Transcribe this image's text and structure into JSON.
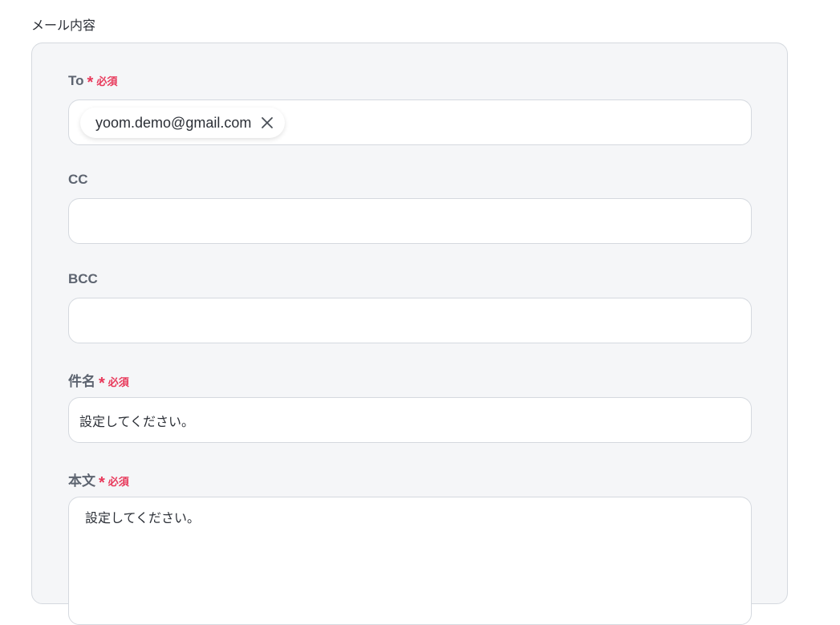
{
  "section": {
    "title": "メール内容"
  },
  "fields": {
    "to": {
      "label": "To",
      "required_mark": "*",
      "required_text": "必須",
      "chips": [
        {
          "email": "yoom.demo@gmail.com"
        }
      ]
    },
    "cc": {
      "label": "CC",
      "value": ""
    },
    "bcc": {
      "label": "BCC",
      "value": ""
    },
    "subject": {
      "label": "件名",
      "required_mark": "*",
      "required_text": "必須",
      "value": "設定してください。"
    },
    "body": {
      "label": "本文",
      "required_mark": "*",
      "required_text": "必須",
      "value": "設定してください。"
    }
  },
  "colors": {
    "required": "#e8385a",
    "panel_bg": "#f5f6f8",
    "border": "#d5d9df",
    "label": "#5d6470"
  },
  "icons": {
    "chip_remove": "close-icon"
  }
}
